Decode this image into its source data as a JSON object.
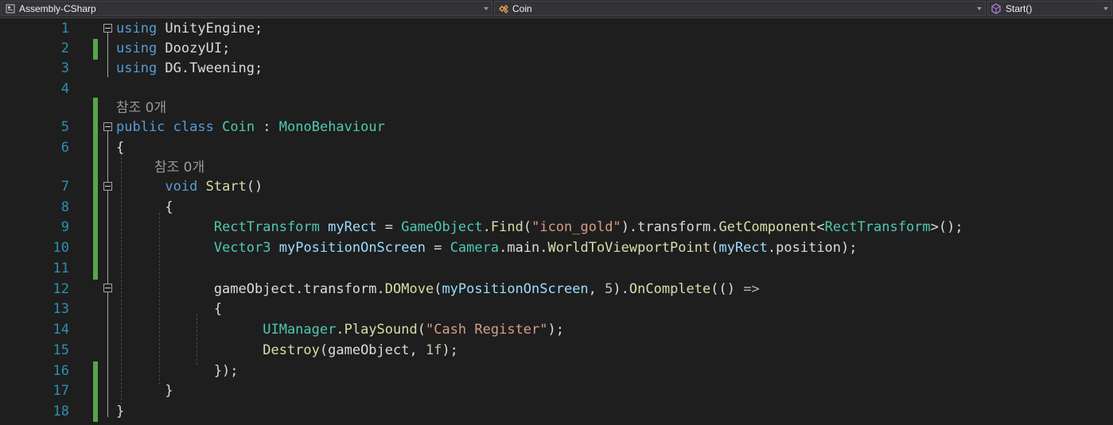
{
  "navbar": {
    "project": "Assembly-CSharp",
    "type": "Coin",
    "member": "Start()"
  },
  "icons": {
    "project": "csharp-project-icon",
    "type": "class-icon",
    "member": "method-icon"
  },
  "colors": {
    "background": "#1e1e1e",
    "line_number": "#2b91af",
    "keyword": "#569cd6",
    "type": "#4ec9b0",
    "method": "#dcdcaa",
    "string": "#d69d85",
    "number": "#b5cea8",
    "identifier": "#9cdcfe",
    "change_bar": "#57a64a"
  },
  "line_numbers": [
    "1",
    "2",
    "3",
    "4",
    "5",
    "6",
    "7",
    "8",
    "9",
    "10",
    "11",
    "12",
    "13",
    "14",
    "15",
    "16",
    "17",
    "18"
  ],
  "codelens": {
    "class_refs": "참조 0개",
    "method_refs": "참조 0개"
  },
  "code": {
    "l1": [
      {
        "t": "kw",
        "v": "using"
      },
      {
        "t": "pl",
        "v": " UnityEngine;"
      }
    ],
    "l2": [
      {
        "t": "kw",
        "v": "using"
      },
      {
        "t": "pl",
        "v": " DoozyUI;"
      }
    ],
    "l3": [
      {
        "t": "kw",
        "v": "using"
      },
      {
        "t": "pl",
        "v": " DG.Tweening;"
      }
    ],
    "l4": [],
    "l5": [
      {
        "t": "kw",
        "v": "public"
      },
      {
        "t": "pl",
        "v": " "
      },
      {
        "t": "kw",
        "v": "class"
      },
      {
        "t": "pl",
        "v": " "
      },
      {
        "t": "ty",
        "v": "Coin"
      },
      {
        "t": "pl",
        "v": " : "
      },
      {
        "t": "ty",
        "v": "MonoBehaviour"
      }
    ],
    "l6": [
      {
        "t": "pl",
        "v": "{"
      }
    ],
    "l7": [
      {
        "t": "pl",
        "v": "      "
      },
      {
        "t": "kw",
        "v": "void"
      },
      {
        "t": "pl",
        "v": " "
      },
      {
        "t": "fn",
        "v": "Start"
      },
      {
        "t": "pl",
        "v": "()"
      }
    ],
    "l8": [
      {
        "t": "pl",
        "v": "      {"
      }
    ],
    "l9": [
      {
        "t": "pl",
        "v": "            "
      },
      {
        "t": "ty",
        "v": "RectTransform"
      },
      {
        "t": "pl",
        "v": " "
      },
      {
        "t": "var",
        "v": "myRect"
      },
      {
        "t": "pl",
        "v": " = "
      },
      {
        "t": "ty",
        "v": "GameObject"
      },
      {
        "t": "pl",
        "v": "."
      },
      {
        "t": "fn",
        "v": "Find"
      },
      {
        "t": "pl",
        "v": "("
      },
      {
        "t": "str",
        "v": "\"icon_gold\""
      },
      {
        "t": "pl",
        "v": ").transform."
      },
      {
        "t": "fn",
        "v": "GetComponent"
      },
      {
        "t": "pl",
        "v": "<"
      },
      {
        "t": "ty",
        "v": "RectTransform"
      },
      {
        "t": "pl",
        "v": ">();"
      }
    ],
    "l10": [
      {
        "t": "pl",
        "v": "            "
      },
      {
        "t": "ty",
        "v": "Vector3"
      },
      {
        "t": "pl",
        "v": " "
      },
      {
        "t": "var",
        "v": "myPositionOnScreen"
      },
      {
        "t": "pl",
        "v": " = "
      },
      {
        "t": "ty",
        "v": "Camera"
      },
      {
        "t": "pl",
        "v": ".main."
      },
      {
        "t": "fn",
        "v": "WorldToViewportPoint"
      },
      {
        "t": "pl",
        "v": "("
      },
      {
        "t": "var",
        "v": "myRect"
      },
      {
        "t": "pl",
        "v": ".position);"
      }
    ],
    "l11": [],
    "l12": [
      {
        "t": "pl",
        "v": "            gameObject.transform."
      },
      {
        "t": "fn",
        "v": "DOMove"
      },
      {
        "t": "pl",
        "v": "("
      },
      {
        "t": "var",
        "v": "myPositionOnScreen"
      },
      {
        "t": "pl",
        "v": ", "
      },
      {
        "t": "num",
        "v": "5"
      },
      {
        "t": "pl",
        "v": ")."
      },
      {
        "t": "fn",
        "v": "OnComplete"
      },
      {
        "t": "pl",
        "v": "(() "
      },
      {
        "t": "op",
        "v": "=>"
      }
    ],
    "l13": [
      {
        "t": "pl",
        "v": "            {"
      }
    ],
    "l14": [
      {
        "t": "pl",
        "v": "                  "
      },
      {
        "t": "ty",
        "v": "UIManager"
      },
      {
        "t": "pl",
        "v": "."
      },
      {
        "t": "fn",
        "v": "PlaySound"
      },
      {
        "t": "pl",
        "v": "("
      },
      {
        "t": "str",
        "v": "\"Cash Register\""
      },
      {
        "t": "pl",
        "v": ");"
      }
    ],
    "l15": [
      {
        "t": "pl",
        "v": "                  "
      },
      {
        "t": "fn",
        "v": "Destroy"
      },
      {
        "t": "pl",
        "v": "(gameObject, "
      },
      {
        "t": "num",
        "v": "1f"
      },
      {
        "t": "pl",
        "v": ");"
      }
    ],
    "l16": [
      {
        "t": "pl",
        "v": "            });"
      }
    ],
    "l17": [
      {
        "t": "pl",
        "v": "      }"
      }
    ],
    "l18": [
      {
        "t": "pl",
        "v": "}"
      }
    ]
  }
}
